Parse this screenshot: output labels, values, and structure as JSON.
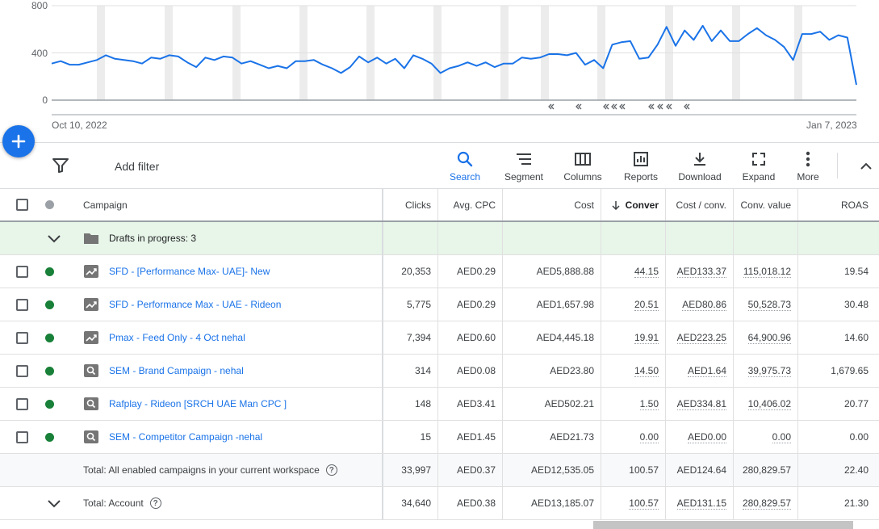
{
  "chart": {
    "y_ticks": [
      "800",
      "400",
      "0"
    ],
    "date_start": "Oct 10, 2022",
    "date_end": "Jan 7, 2023",
    "line_color": "#1a73e8",
    "y_axis_max": 800
  },
  "chart_data": {
    "type": "line",
    "x_start": "Oct 10, 2022",
    "x_end": "Jan 7, 2023",
    "ylim": [
      0,
      800
    ],
    "y_ticks": [
      0,
      400,
      800
    ],
    "values": [
      310,
      330,
      300,
      300,
      320,
      340,
      380,
      350,
      340,
      330,
      310,
      360,
      350,
      380,
      370,
      320,
      280,
      360,
      340,
      370,
      360,
      310,
      330,
      300,
      270,
      290,
      270,
      330,
      330,
      340,
      300,
      270,
      230,
      280,
      370,
      320,
      360,
      310,
      350,
      270,
      380,
      350,
      310,
      230,
      270,
      290,
      320,
      290,
      320,
      280,
      310,
      310,
      360,
      350,
      360,
      390,
      390,
      380,
      400,
      300,
      340,
      270,
      470,
      490,
      500,
      350,
      360,
      470,
      620,
      460,
      590,
      510,
      630,
      500,
      590,
      500,
      500,
      560,
      610,
      550,
      510,
      450,
      340,
      560,
      560,
      580,
      510,
      550,
      530,
      130
    ]
  },
  "fab": {
    "label": "+"
  },
  "toolbar": {
    "add_filter": "Add filter",
    "buttons": [
      {
        "label": "Search",
        "icon": "search-icon"
      },
      {
        "label": "Segment",
        "icon": "segment-icon"
      },
      {
        "label": "Columns",
        "icon": "columns-icon"
      },
      {
        "label": "Reports",
        "icon": "reports-icon"
      },
      {
        "label": "Download",
        "icon": "download-icon"
      },
      {
        "label": "Expand",
        "icon": "expand-icon"
      },
      {
        "label": "More",
        "icon": "more-vert-icon"
      }
    ]
  },
  "table": {
    "headers": {
      "campaign": "Campaign",
      "clicks": "Clicks",
      "avg_cpc": "Avg. CPC",
      "cost": "Cost",
      "conversions": "Conver",
      "cost_per_conv": "Cost / conv.",
      "conv_value": "Conv. value",
      "roas": "ROAS"
    },
    "drafts_label": "Drafts in progress: 3",
    "rows": [
      {
        "name": "SFD - [Performance Max- UAE]- New",
        "type": "pmax",
        "clicks": "20,353",
        "avg_cpc": "AED0.29",
        "cost": "AED5,888.88",
        "conversions": "44.15",
        "cost_per_conv": "AED133.37",
        "conv_value": "115,018.12",
        "roas": "19.54"
      },
      {
        "name": "SFD - Performance Max - UAE - Rideon",
        "type": "pmax",
        "clicks": "5,775",
        "avg_cpc": "AED0.29",
        "cost": "AED1,657.98",
        "conversions": "20.51",
        "cost_per_conv": "AED80.86",
        "conv_value": "50,528.73",
        "roas": "30.48"
      },
      {
        "name": "Pmax - Feed Only - 4 Oct nehal",
        "type": "pmax",
        "clicks": "7,394",
        "avg_cpc": "AED0.60",
        "cost": "AED4,445.18",
        "conversions": "19.91",
        "cost_per_conv": "AED223.25",
        "conv_value": "64,900.96",
        "roas": "14.60"
      },
      {
        "name": "SEM - Brand Campaign - nehal",
        "type": "search",
        "clicks": "314",
        "avg_cpc": "AED0.08",
        "cost": "AED23.80",
        "conversions": "14.50",
        "cost_per_conv": "AED1.64",
        "conv_value": "39,975.73",
        "roas": "1,679.65"
      },
      {
        "name": "Rafplay - Rideon [SRCH UAE Man CPC ]",
        "type": "search",
        "clicks": "148",
        "avg_cpc": "AED3.41",
        "cost": "AED502.21",
        "conversions": "1.50",
        "cost_per_conv": "AED334.81",
        "conv_value": "10,406.02",
        "roas": "20.77"
      },
      {
        "name": "SEM - Competitor Campaign -nehal",
        "type": "search",
        "clicks": "15",
        "avg_cpc": "AED1.45",
        "cost": "AED21.73",
        "conversions": "0.00",
        "cost_per_conv": "AED0.00",
        "conv_value": "0.00",
        "roas": "0.00"
      }
    ],
    "total_enabled": {
      "label": "Total: All enabled campaigns in your current workspace",
      "clicks": "33,997",
      "avg_cpc": "AED0.37",
      "cost": "AED12,535.05",
      "conversions": "100.57",
      "cost_per_conv": "AED124.64",
      "conv_value": "280,829.57",
      "roas": "22.40"
    },
    "total_account": {
      "label": "Total: Account",
      "clicks": "34,640",
      "avg_cpc": "AED0.38",
      "cost": "AED13,185.07",
      "conversions": "100.57",
      "cost_per_conv": "AED131.15",
      "conv_value": "280,829.57",
      "roas": "21.30"
    },
    "help_glyph": "?",
    "status_color": "#188038"
  }
}
